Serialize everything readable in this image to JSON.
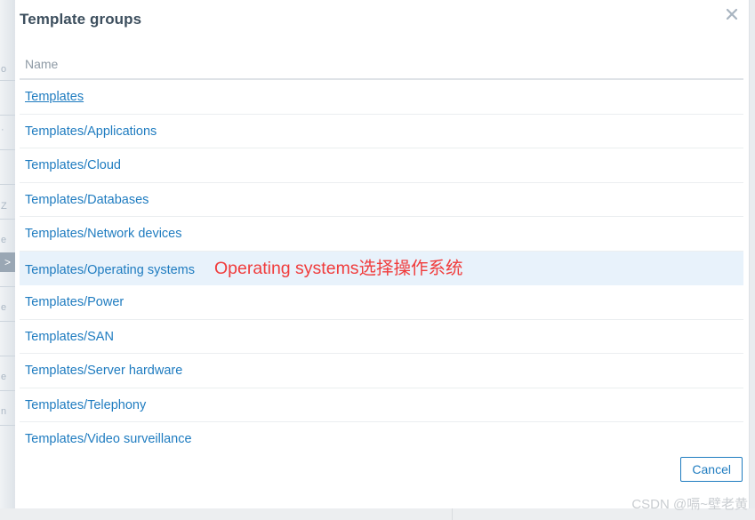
{
  "dialog": {
    "title": "Template groups",
    "close_icon": "close-icon"
  },
  "table": {
    "column_header": "Name",
    "rows": [
      {
        "label": "Templates",
        "state": "hovered",
        "annotation": ""
      },
      {
        "label": "Templates/Applications",
        "state": "normal",
        "annotation": ""
      },
      {
        "label": "Templates/Cloud",
        "state": "normal",
        "annotation": ""
      },
      {
        "label": "Templates/Databases",
        "state": "normal",
        "annotation": ""
      },
      {
        "label": "Templates/Network devices",
        "state": "normal",
        "annotation": ""
      },
      {
        "label": "Templates/Operating systems",
        "state": "selected",
        "annotation": "Operating systems选择操作系统"
      },
      {
        "label": "Templates/Power",
        "state": "normal",
        "annotation": ""
      },
      {
        "label": "Templates/SAN",
        "state": "normal",
        "annotation": ""
      },
      {
        "label": "Templates/Server hardware",
        "state": "normal",
        "annotation": ""
      },
      {
        "label": "Templates/Telephony",
        "state": "normal",
        "annotation": ""
      },
      {
        "label": "Templates/Video surveillance",
        "state": "normal",
        "annotation": ""
      }
    ]
  },
  "footer": {
    "cancel_label": "Cancel"
  },
  "watermark": {
    "text": "CSDN @嗝~壁老黄"
  },
  "colors": {
    "link": "#1f7cc0",
    "selected_row_bg": "#e8f2fb",
    "annotation_red": "#f03c3c",
    "title": "#3d4f5e",
    "header_text": "#8e9aa5"
  },
  "background": {
    "ghost_fragments": [
      "o",
      "·",
      "Z",
      "e",
      ">",
      "e",
      "e",
      "n"
    ]
  }
}
